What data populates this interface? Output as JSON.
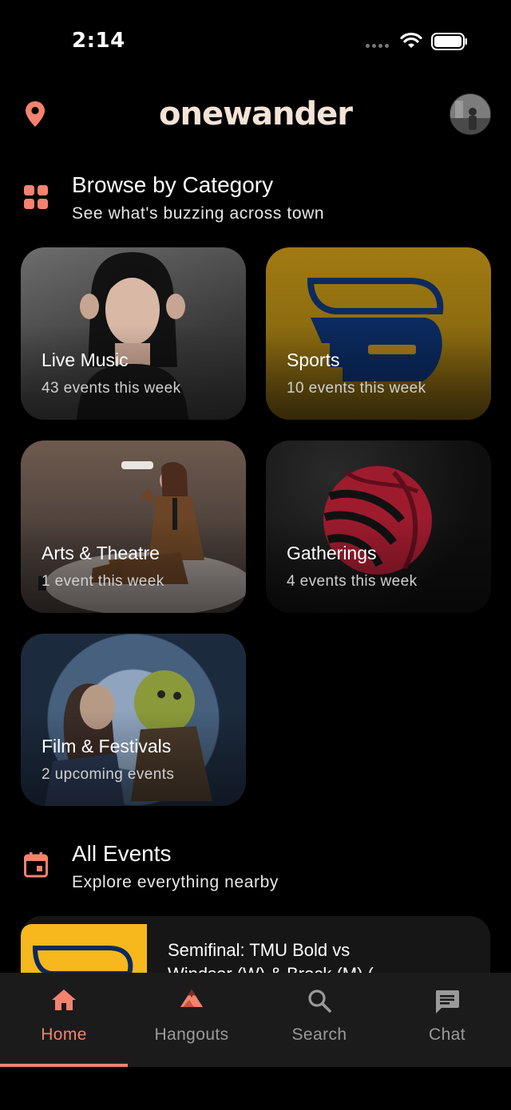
{
  "status_bar": {
    "time": "2:14"
  },
  "header": {
    "logo": "onewander"
  },
  "browse": {
    "title": "Browse by Category",
    "subtitle": "See what's buzzing across town",
    "categories": [
      {
        "title": "Live Music",
        "subtitle": "43 events this week"
      },
      {
        "title": "Sports",
        "subtitle": "10 events this week"
      },
      {
        "title": "Arts & Theatre",
        "subtitle": "1 event this week"
      },
      {
        "title": "Gatherings",
        "subtitle": "4 events this week"
      },
      {
        "title": "Film & Festivals",
        "subtitle": "2 upcoming events"
      }
    ]
  },
  "all_events": {
    "title": "All Events",
    "subtitle": "Explore everything nearby",
    "items": [
      {
        "title": "Semifinal: TMU Bold vs Windsor (W) & Brock (M) ("
      }
    ]
  },
  "bottom_nav": {
    "items": [
      {
        "label": "Home",
        "icon": "home-icon",
        "active": true
      },
      {
        "label": "Hangouts",
        "icon": "mountain-icon",
        "active": false
      },
      {
        "label": "Search",
        "icon": "search-icon",
        "active": false
      },
      {
        "label": "Chat",
        "icon": "chat-icon",
        "active": false
      }
    ]
  },
  "colors": {
    "accent": "#f4826e",
    "background": "#000000",
    "logo": "#f4e3d7"
  }
}
